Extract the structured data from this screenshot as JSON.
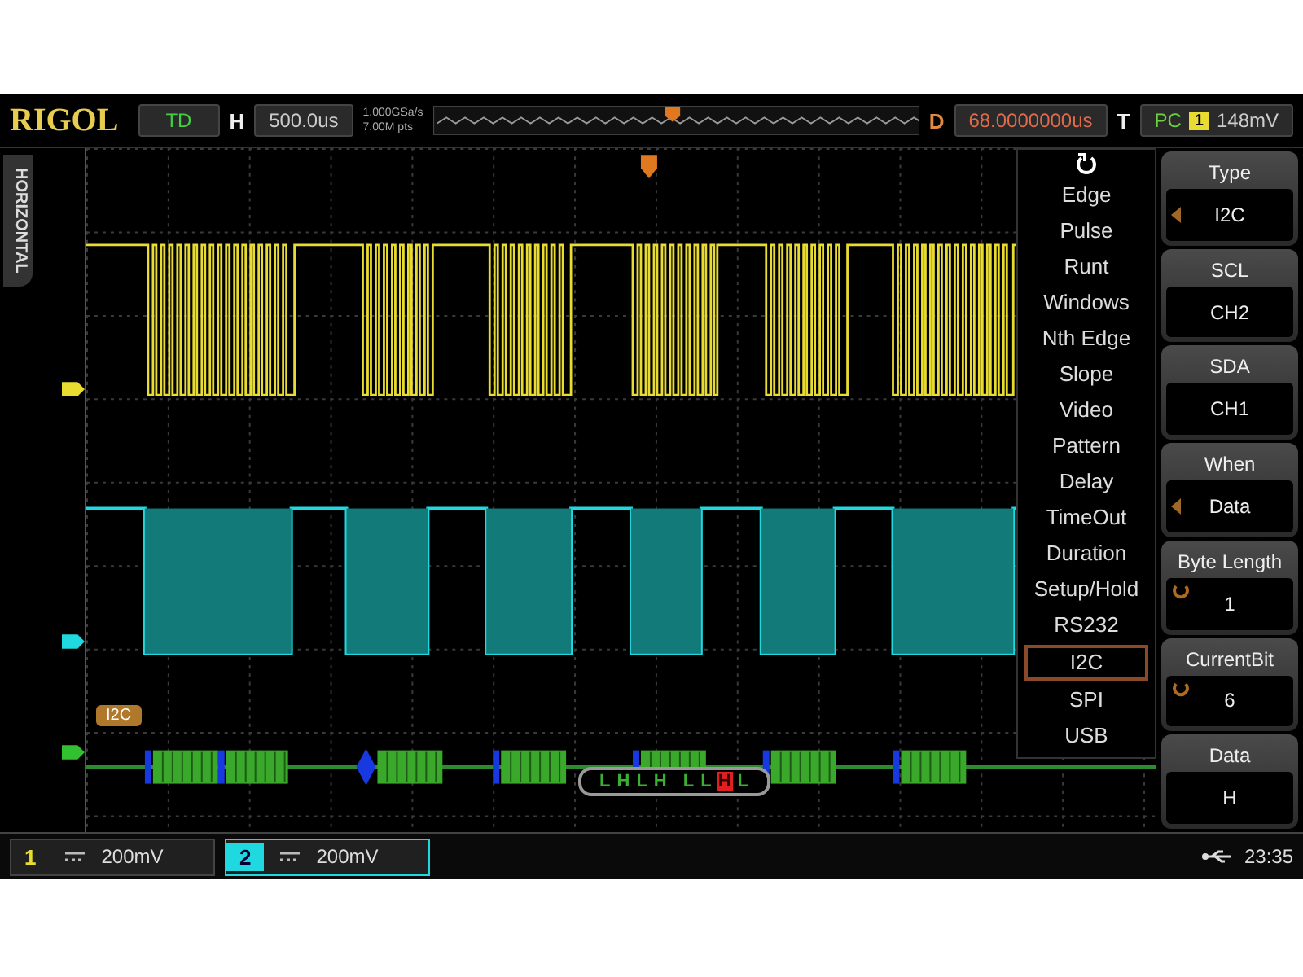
{
  "brand": "RIGOL",
  "status": "TD",
  "horizontal": {
    "label": "H",
    "timebase": "500.0us",
    "sample_rate": "1.000GSa/s",
    "memory_depth": "7.00M pts"
  },
  "delay": {
    "label": "D",
    "value": "68.0000000us"
  },
  "trigger": {
    "label": "T",
    "mode": "PC",
    "source": "1",
    "level": "148mV"
  },
  "side_tab": "HORIZONTAL",
  "decode": {
    "label": "I2C",
    "bits": [
      {
        "bit": "L",
        "selected": false
      },
      {
        "bit": "H",
        "selected": false
      },
      {
        "bit": "L",
        "selected": false
      },
      {
        "bit": "H",
        "selected": false
      },
      {
        "bit": "L",
        "selected": false
      },
      {
        "bit": "L",
        "selected": false
      },
      {
        "bit": "H",
        "selected": true
      },
      {
        "bit": "L",
        "selected": false
      }
    ]
  },
  "trigger_menu": [
    {
      "label": "Edge",
      "selected": false
    },
    {
      "label": "Pulse",
      "selected": false
    },
    {
      "label": "Runt",
      "selected": false
    },
    {
      "label": "Windows",
      "selected": false
    },
    {
      "label": "Nth Edge",
      "selected": false
    },
    {
      "label": "Slope",
      "selected": false
    },
    {
      "label": "Video",
      "selected": false
    },
    {
      "label": "Pattern",
      "selected": false
    },
    {
      "label": "Delay",
      "selected": false
    },
    {
      "label": "TimeOut",
      "selected": false
    },
    {
      "label": "Duration",
      "selected": false
    },
    {
      "label": "Setup/Hold",
      "selected": false
    },
    {
      "label": "RS232",
      "selected": false
    },
    {
      "label": "I2C",
      "selected": true
    },
    {
      "label": "SPI",
      "selected": false
    },
    {
      "label": "USB",
      "selected": false
    }
  ],
  "softkeys": [
    {
      "title": "Type",
      "value": "I2C",
      "kind": "select"
    },
    {
      "title": "SCL",
      "value": "CH2",
      "kind": "plain"
    },
    {
      "title": "SDA",
      "value": "CH1",
      "kind": "plain"
    },
    {
      "title": "When",
      "value": "Data",
      "kind": "select"
    },
    {
      "title": "Byte Length",
      "value": "1",
      "kind": "knob"
    },
    {
      "title": "CurrentBit",
      "value": "6",
      "kind": "knob"
    },
    {
      "title": "Data",
      "value": "H",
      "kind": "plain"
    }
  ],
  "channels": [
    {
      "number": "1",
      "scale": "200mV",
      "color": "#e8dc30",
      "selected": false
    },
    {
      "number": "2",
      "scale": "200mV",
      "color": "#20d8e0",
      "selected": true
    }
  ],
  "clock": "23:35"
}
